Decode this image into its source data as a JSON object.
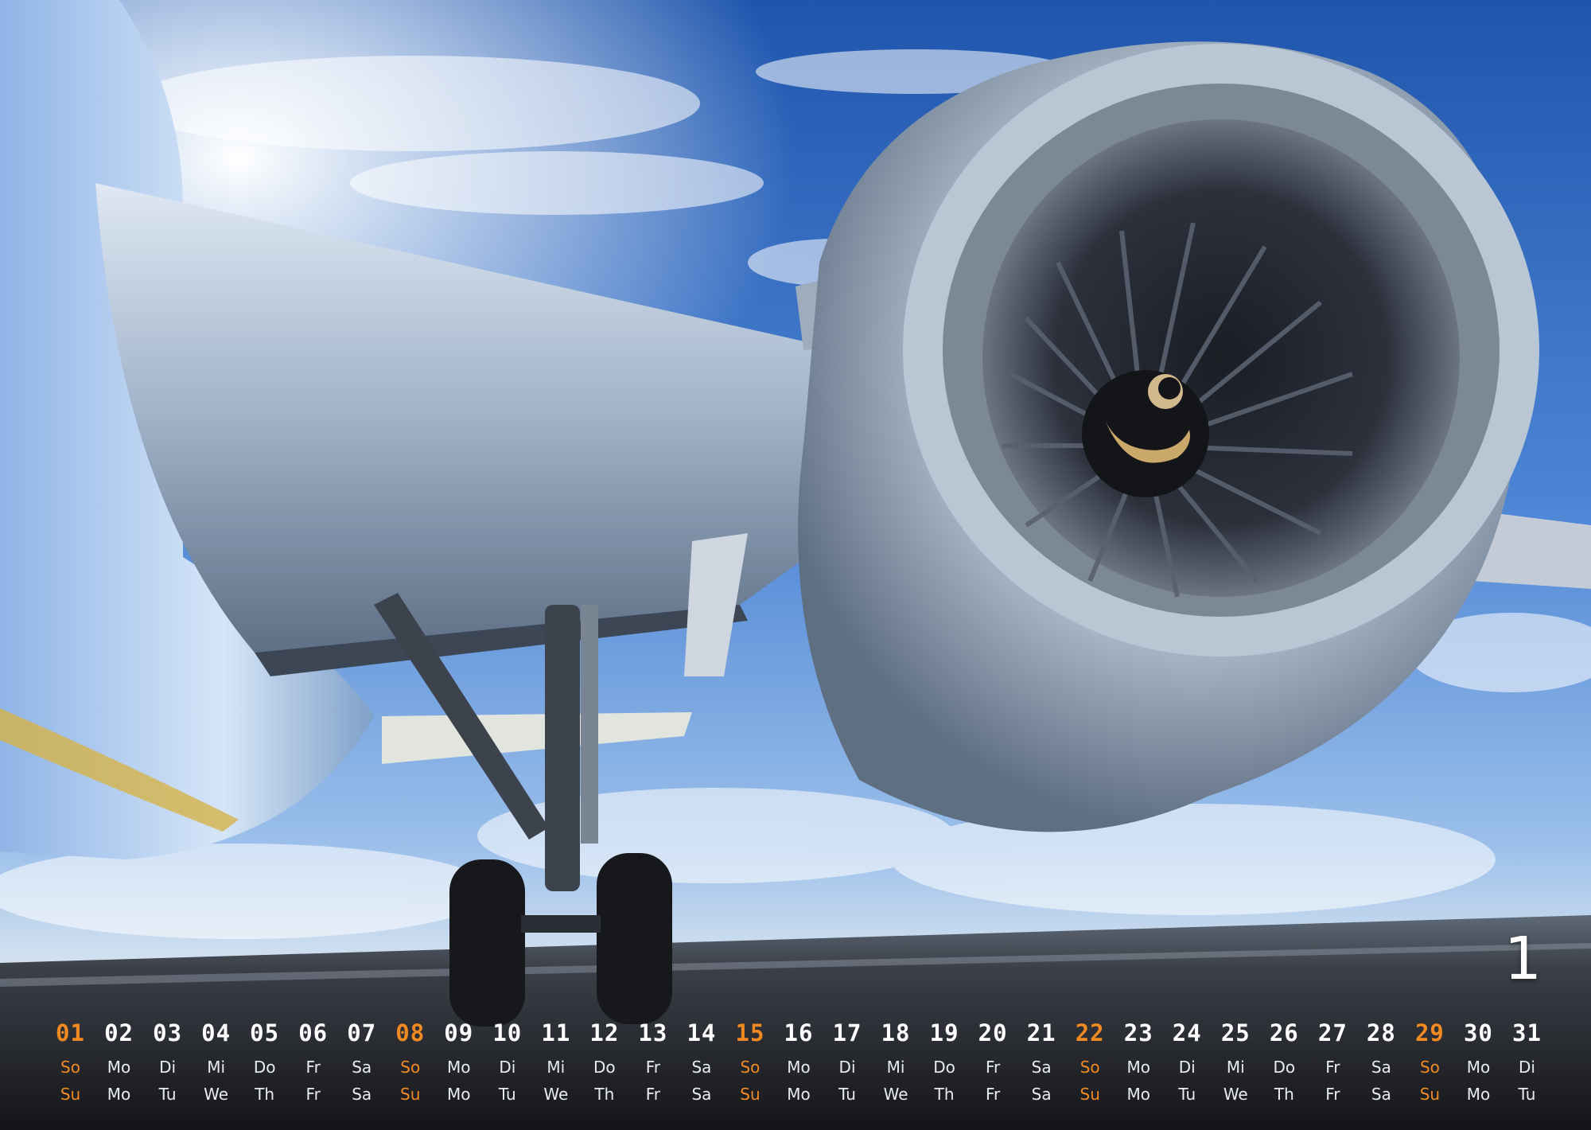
{
  "calendar": {
    "month_number": "1",
    "days": [
      "01",
      "02",
      "03",
      "04",
      "05",
      "06",
      "07",
      "08",
      "09",
      "10",
      "11",
      "12",
      "13",
      "14",
      "15",
      "16",
      "17",
      "18",
      "19",
      "20",
      "21",
      "22",
      "23",
      "24",
      "25",
      "26",
      "27",
      "28",
      "29",
      "30",
      "31"
    ],
    "weekdays_de": [
      "So",
      "Mo",
      "Di",
      "Mi",
      "Do",
      "Fr",
      "Sa",
      "So",
      "Mo",
      "Di",
      "Mi",
      "Do",
      "Fr",
      "Sa",
      "So",
      "Mo",
      "Di",
      "Mi",
      "Do",
      "Fr",
      "Sa",
      "So",
      "Mo",
      "Di",
      "Mi",
      "Do",
      "Fr",
      "Sa",
      "So",
      "Mo",
      "Di"
    ],
    "weekdays_en": [
      "Su",
      "Mo",
      "Tu",
      "We",
      "Th",
      "Fr",
      "Sa",
      "Su",
      "Mo",
      "Tu",
      "We",
      "Th",
      "Fr",
      "Sa",
      "Su",
      "Mo",
      "Tu",
      "We",
      "Th",
      "Fr",
      "Sa",
      "Su",
      "Mo",
      "Tu",
      "We",
      "Th",
      "Fr",
      "Sa",
      "Su",
      "Mo",
      "Tu"
    ],
    "sunday_days": [
      "01",
      "08",
      "15",
      "22",
      "29"
    ]
  },
  "colors": {
    "sunday_accent": "#f28a22",
    "text": "#ffffff",
    "sky_top": "#2d63b8",
    "sky_mid": "#6fa2e0",
    "runway": "#2a2c31"
  },
  "photo": {
    "subject": "aircraft-wing-jet-engine-landing-gear"
  }
}
